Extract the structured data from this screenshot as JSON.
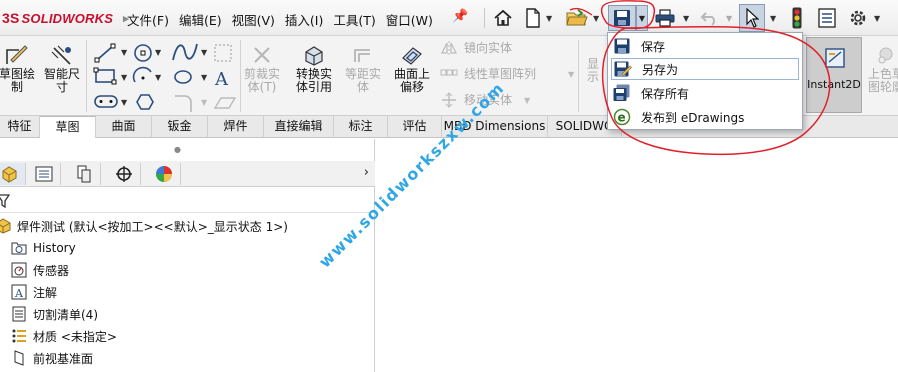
{
  "app": {
    "logo_text": "SOLIDWORKS",
    "logo_mark": "3S"
  },
  "menu": [
    "文件(F)",
    "编辑(E)",
    "视图(V)",
    "插入(I)",
    "工具(T)",
    "窗口(W)"
  ],
  "quick_access": {
    "icons": [
      "home-icon",
      "new-file-icon",
      "open-folder-icon",
      "save-icon",
      "print-icon",
      "undo-icon",
      "select-cursor-icon",
      "rebuild-traffic-light-icon",
      "file-properties-icon",
      "options-gear-icon"
    ]
  },
  "ribbon": {
    "large": [
      {
        "label": "草图绘\n制",
        "icon": "sketch-icon",
        "enabled": true
      },
      {
        "label": "智能尺\n寸",
        "icon": "smart-dimension-icon",
        "enabled": true
      },
      {
        "label": "剪裁实\n体(T)",
        "icon": "trim-entities-icon",
        "enabled": false
      },
      {
        "label": "转换实\n体引用",
        "icon": "convert-entities-icon",
        "enabled": true
      },
      {
        "label": "等距实\n体",
        "icon": "offset-entities-icon",
        "enabled": false
      },
      {
        "label": "曲面上\n偏移",
        "icon": "offset-on-surface-icon",
        "enabled": true
      },
      {
        "label": "显\n示",
        "icon": "display-relations-icon",
        "enabled": false
      },
      {
        "label": "上色草\n图轮廓",
        "icon": "shaded-sketch-icon",
        "enabled": false
      }
    ],
    "small": [
      {
        "label": "镜向实体",
        "icon": "mirror-entities-icon"
      },
      {
        "label": "线性草图阵列",
        "icon": "linear-pattern-icon"
      },
      {
        "label": "移动实体",
        "icon": "move-entities-icon"
      }
    ],
    "instant2d": "Instant2D"
  },
  "tabs": [
    "特征",
    "草图",
    "曲面",
    "钣金",
    "焊件",
    "直接编辑",
    "标注",
    "评估",
    "MBD Dimensions",
    "SOLIDWO"
  ],
  "active_tab": "草图",
  "feature_tree": {
    "root": "焊件测试 (默认<按加工><<默认>_显示状态 1>)",
    "items": [
      {
        "label": "History",
        "icon": "history-folder-icon"
      },
      {
        "label": "传感器",
        "icon": "sensor-icon"
      },
      {
        "label": "注解",
        "icon": "annotations-icon"
      },
      {
        "label": "切割清单(4)",
        "icon": "cut-list-icon"
      },
      {
        "label": "材质 <未指定>",
        "icon": "material-icon"
      },
      {
        "label": "前视基准面",
        "icon": "plane-icon"
      }
    ]
  },
  "save_menu": {
    "items": [
      {
        "label": "保存",
        "icon": "save-icon"
      },
      {
        "label": "另存为",
        "icon": "save-as-icon"
      },
      {
        "label": "保存所有",
        "icon": "save-all-icon"
      },
      {
        "label": "发布到 eDrawings",
        "icon": "edrawings-icon"
      }
    ],
    "hover_index": 1
  },
  "watermark": "www.solidworkszxw.com",
  "colors": {
    "logo_red": "#c8102e",
    "watermark_blue": "#2fa7e6",
    "annotation_red": "#e0202a",
    "select_highlight": "#c9d4e2"
  }
}
